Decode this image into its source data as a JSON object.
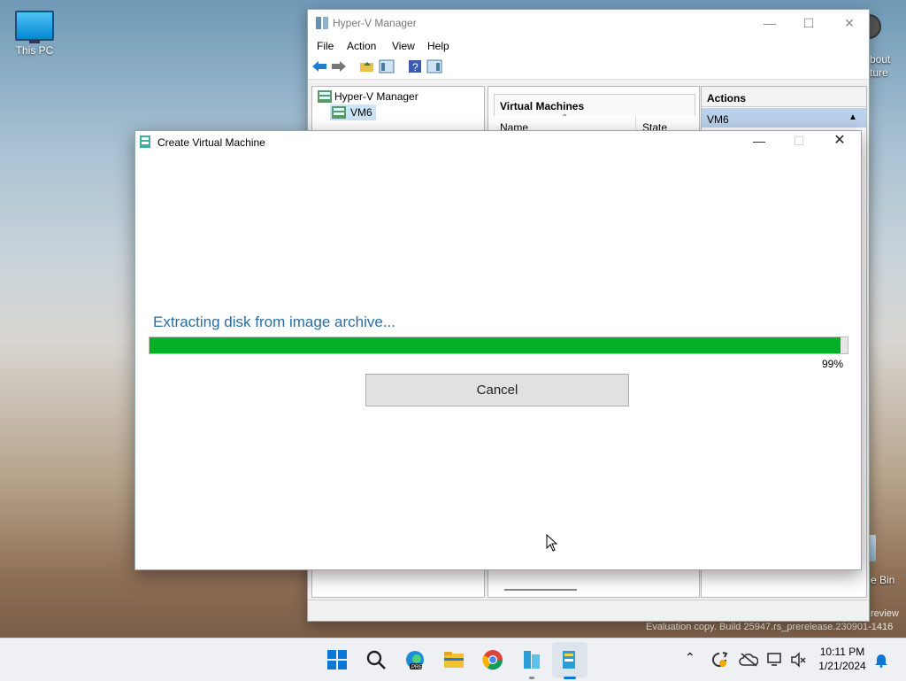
{
  "desktop": {
    "this_pc_label": "This PC",
    "right_icon_top_label_1": "bout",
    "right_icon_top_label_2": "ture",
    "recycle_bin_label": "e Bin",
    "watermark_line": "Evaluation copy. Build 25947.rs_prerelease.230901-1416",
    "watermark_preview": "review"
  },
  "hyperv": {
    "title": "Hyper-V Manager",
    "menu": [
      "File",
      "Action",
      "View",
      "Help"
    ],
    "tree_root": "Hyper-V Manager",
    "tree_child": "VM6",
    "center_header": "Virtual Machines",
    "columns": [
      "Name",
      "State"
    ],
    "actions_header": "Actions",
    "actions_selected": "VM6"
  },
  "dialog": {
    "title": "Create Virtual Machine",
    "status_text": "Extracting disk from image archive...",
    "progress_percent": 99,
    "progress_label": "99%",
    "cancel_label": "Cancel"
  },
  "taskbar": {
    "time": "10:11 PM",
    "date": "1/21/2024"
  },
  "colors": {
    "progress_green": "#06b025",
    "status_blue": "#2a6ea0",
    "selection_blue": "#cce4f7"
  }
}
